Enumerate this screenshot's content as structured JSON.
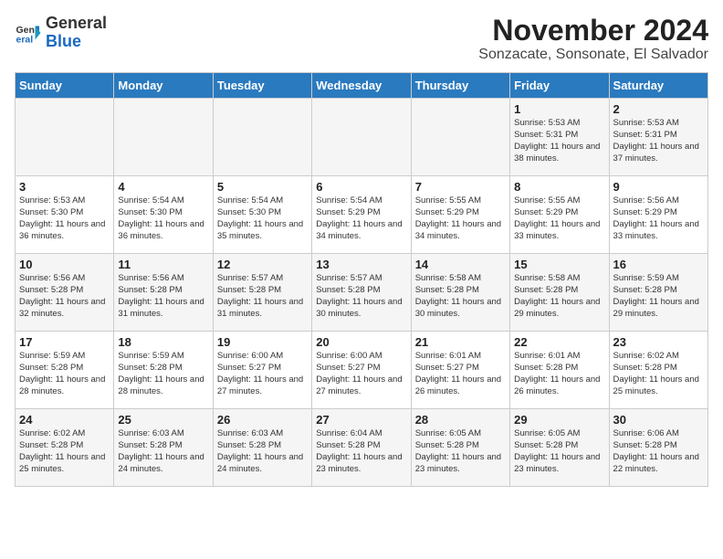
{
  "logo": {
    "general": "General",
    "blue": "Blue"
  },
  "title": "November 2024",
  "location": "Sonzacate, Sonsonate, El Salvador",
  "days_of_week": [
    "Sunday",
    "Monday",
    "Tuesday",
    "Wednesday",
    "Thursday",
    "Friday",
    "Saturday"
  ],
  "weeks": [
    [
      {
        "day": "",
        "sunrise": "",
        "sunset": "",
        "daylight": ""
      },
      {
        "day": "",
        "sunrise": "",
        "sunset": "",
        "daylight": ""
      },
      {
        "day": "",
        "sunrise": "",
        "sunset": "",
        "daylight": ""
      },
      {
        "day": "",
        "sunrise": "",
        "sunset": "",
        "daylight": ""
      },
      {
        "day": "",
        "sunrise": "",
        "sunset": "",
        "daylight": ""
      },
      {
        "day": "1",
        "sunrise": "Sunrise: 5:53 AM",
        "sunset": "Sunset: 5:31 PM",
        "daylight": "Daylight: 11 hours and 38 minutes."
      },
      {
        "day": "2",
        "sunrise": "Sunrise: 5:53 AM",
        "sunset": "Sunset: 5:31 PM",
        "daylight": "Daylight: 11 hours and 37 minutes."
      }
    ],
    [
      {
        "day": "3",
        "sunrise": "Sunrise: 5:53 AM",
        "sunset": "Sunset: 5:30 PM",
        "daylight": "Daylight: 11 hours and 36 minutes."
      },
      {
        "day": "4",
        "sunrise": "Sunrise: 5:54 AM",
        "sunset": "Sunset: 5:30 PM",
        "daylight": "Daylight: 11 hours and 36 minutes."
      },
      {
        "day": "5",
        "sunrise": "Sunrise: 5:54 AM",
        "sunset": "Sunset: 5:30 PM",
        "daylight": "Daylight: 11 hours and 35 minutes."
      },
      {
        "day": "6",
        "sunrise": "Sunrise: 5:54 AM",
        "sunset": "Sunset: 5:29 PM",
        "daylight": "Daylight: 11 hours and 34 minutes."
      },
      {
        "day": "7",
        "sunrise": "Sunrise: 5:55 AM",
        "sunset": "Sunset: 5:29 PM",
        "daylight": "Daylight: 11 hours and 34 minutes."
      },
      {
        "day": "8",
        "sunrise": "Sunrise: 5:55 AM",
        "sunset": "Sunset: 5:29 PM",
        "daylight": "Daylight: 11 hours and 33 minutes."
      },
      {
        "day": "9",
        "sunrise": "Sunrise: 5:56 AM",
        "sunset": "Sunset: 5:29 PM",
        "daylight": "Daylight: 11 hours and 33 minutes."
      }
    ],
    [
      {
        "day": "10",
        "sunrise": "Sunrise: 5:56 AM",
        "sunset": "Sunset: 5:28 PM",
        "daylight": "Daylight: 11 hours and 32 minutes."
      },
      {
        "day": "11",
        "sunrise": "Sunrise: 5:56 AM",
        "sunset": "Sunset: 5:28 PM",
        "daylight": "Daylight: 11 hours and 31 minutes."
      },
      {
        "day": "12",
        "sunrise": "Sunrise: 5:57 AM",
        "sunset": "Sunset: 5:28 PM",
        "daylight": "Daylight: 11 hours and 31 minutes."
      },
      {
        "day": "13",
        "sunrise": "Sunrise: 5:57 AM",
        "sunset": "Sunset: 5:28 PM",
        "daylight": "Daylight: 11 hours and 30 minutes."
      },
      {
        "day": "14",
        "sunrise": "Sunrise: 5:58 AM",
        "sunset": "Sunset: 5:28 PM",
        "daylight": "Daylight: 11 hours and 30 minutes."
      },
      {
        "day": "15",
        "sunrise": "Sunrise: 5:58 AM",
        "sunset": "Sunset: 5:28 PM",
        "daylight": "Daylight: 11 hours and 29 minutes."
      },
      {
        "day": "16",
        "sunrise": "Sunrise: 5:59 AM",
        "sunset": "Sunset: 5:28 PM",
        "daylight": "Daylight: 11 hours and 29 minutes."
      }
    ],
    [
      {
        "day": "17",
        "sunrise": "Sunrise: 5:59 AM",
        "sunset": "Sunset: 5:28 PM",
        "daylight": "Daylight: 11 hours and 28 minutes."
      },
      {
        "day": "18",
        "sunrise": "Sunrise: 5:59 AM",
        "sunset": "Sunset: 5:28 PM",
        "daylight": "Daylight: 11 hours and 28 minutes."
      },
      {
        "day": "19",
        "sunrise": "Sunrise: 6:00 AM",
        "sunset": "Sunset: 5:27 PM",
        "daylight": "Daylight: 11 hours and 27 minutes."
      },
      {
        "day": "20",
        "sunrise": "Sunrise: 6:00 AM",
        "sunset": "Sunset: 5:27 PM",
        "daylight": "Daylight: 11 hours and 27 minutes."
      },
      {
        "day": "21",
        "sunrise": "Sunrise: 6:01 AM",
        "sunset": "Sunset: 5:27 PM",
        "daylight": "Daylight: 11 hours and 26 minutes."
      },
      {
        "day": "22",
        "sunrise": "Sunrise: 6:01 AM",
        "sunset": "Sunset: 5:28 PM",
        "daylight": "Daylight: 11 hours and 26 minutes."
      },
      {
        "day": "23",
        "sunrise": "Sunrise: 6:02 AM",
        "sunset": "Sunset: 5:28 PM",
        "daylight": "Daylight: 11 hours and 25 minutes."
      }
    ],
    [
      {
        "day": "24",
        "sunrise": "Sunrise: 6:02 AM",
        "sunset": "Sunset: 5:28 PM",
        "daylight": "Daylight: 11 hours and 25 minutes."
      },
      {
        "day": "25",
        "sunrise": "Sunrise: 6:03 AM",
        "sunset": "Sunset: 5:28 PM",
        "daylight": "Daylight: 11 hours and 24 minutes."
      },
      {
        "day": "26",
        "sunrise": "Sunrise: 6:03 AM",
        "sunset": "Sunset: 5:28 PM",
        "daylight": "Daylight: 11 hours and 24 minutes."
      },
      {
        "day": "27",
        "sunrise": "Sunrise: 6:04 AM",
        "sunset": "Sunset: 5:28 PM",
        "daylight": "Daylight: 11 hours and 23 minutes."
      },
      {
        "day": "28",
        "sunrise": "Sunrise: 6:05 AM",
        "sunset": "Sunset: 5:28 PM",
        "daylight": "Daylight: 11 hours and 23 minutes."
      },
      {
        "day": "29",
        "sunrise": "Sunrise: 6:05 AM",
        "sunset": "Sunset: 5:28 PM",
        "daylight": "Daylight: 11 hours and 23 minutes."
      },
      {
        "day": "30",
        "sunrise": "Sunrise: 6:06 AM",
        "sunset": "Sunset: 5:28 PM",
        "daylight": "Daylight: 11 hours and 22 minutes."
      }
    ]
  ]
}
